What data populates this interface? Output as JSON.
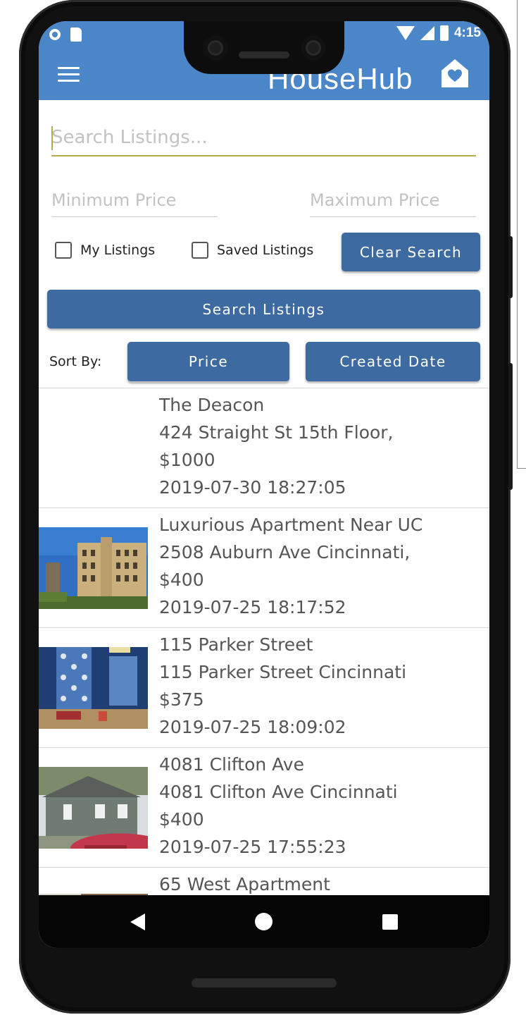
{
  "status_bar": {
    "time": "4:15"
  },
  "app": {
    "title": "HouseHub"
  },
  "search": {
    "placeholder": "Search Listings...",
    "min_price_placeholder": "Minimum Price",
    "max_price_placeholder": "Maximum Price"
  },
  "filters": {
    "my_listings": "My Listings",
    "saved_listings": "Saved Listings",
    "clear_label": "Clear Search",
    "search_label": "Search Listings"
  },
  "sort": {
    "label": "Sort By:",
    "price_label": "Price",
    "created_label": "Created Date"
  },
  "listings": [
    {
      "name": "The Deacon",
      "address": "424 Straight St 15th Floor,",
      "price": "$1000",
      "date": "2019-07-30 18:27:05",
      "image": "none"
    },
    {
      "name": "Luxurious Apartment Near UC",
      "address": "2508 Auburn Ave Cincinnati,",
      "price": "$400",
      "date": "2019-07-25 18:17:52",
      "image": "brick-apartment-building"
    },
    {
      "name": "115 Parker Street",
      "address": "115 Parker Street Cincinnati",
      "price": "$375",
      "date": "2019-07-25 18:09:02",
      "image": "bathroom-blue-wall"
    },
    {
      "name": "4081 Clifton Ave",
      "address": "4081 Clifton Ave Cincinnati",
      "price": "$400",
      "date": "2019-07-25 17:55:23",
      "image": "gray-house-red-car"
    },
    {
      "name": "65 West Apartment",
      "address": "",
      "price": "",
      "date": "",
      "image": "building-partial"
    }
  ],
  "colors": {
    "header": "#4a86c8",
    "button": "#3d6aa0",
    "accent": "#b8a94a"
  }
}
